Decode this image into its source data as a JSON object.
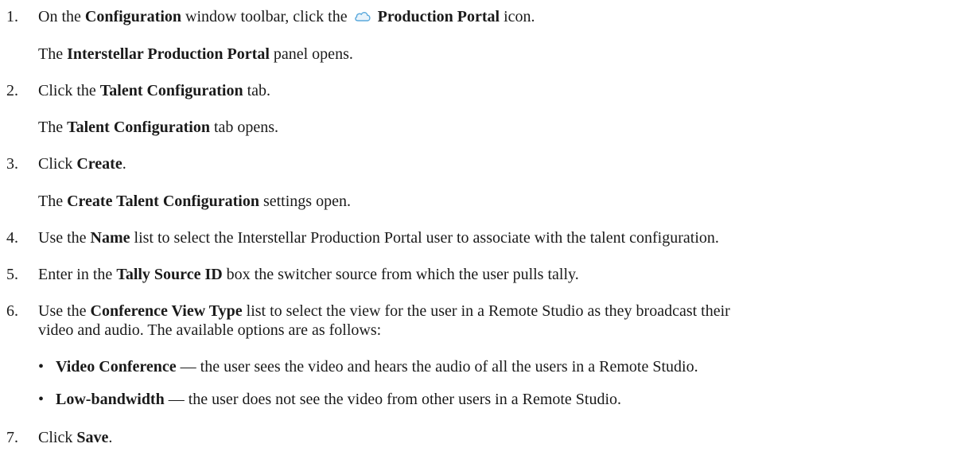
{
  "steps": [
    {
      "num": "1.",
      "pre": "On the ",
      "b1": "Configuration",
      "mid": " window toolbar, click the ",
      "icon": "cloud-icon",
      "b2": "Production Portal",
      "post": " icon.",
      "result_pre": "The ",
      "result_b": "Interstellar Production Portal",
      "result_post": " panel opens."
    },
    {
      "num": "2.",
      "pre": "Click the ",
      "b1": "Talent Configuration",
      "post": " tab.",
      "result_pre": "The ",
      "result_b": "Talent Configuration",
      "result_post": " tab opens."
    },
    {
      "num": "3.",
      "pre": "Click ",
      "b1": "Create",
      "post": ".",
      "result_pre": "The ",
      "result_b": "Create Talent Configuration",
      "result_post": " settings open."
    },
    {
      "num": "4.",
      "pre": "Use the ",
      "b1": "Name",
      "post": " list to select the Interstellar Production Portal user to associate with the talent configuration."
    },
    {
      "num": "5.",
      "pre": "Enter in the ",
      "b1": "Tally Source ID",
      "post": " box the switcher source from which the user pulls tally."
    },
    {
      "num": "6.",
      "pre": "Use the ",
      "b1": "Conference View Type",
      "post": " list to select the view for the user in a Remote Studio as they broadcast their",
      "cont": "video and audio. The available options are as follows:",
      "bullets": [
        {
          "b": "Video Conference",
          "text": " — the user sees the video and hears the audio of all the users in a Remote Studio."
        },
        {
          "b": "Low-bandwidth",
          "text": " — the user does not see the video from other users in a Remote Studio."
        }
      ]
    },
    {
      "num": "7.",
      "pre": "Click ",
      "b1": "Save",
      "post": "."
    }
  ],
  "bullet_glyph": "•",
  "icon_colors": {
    "cloud_fill": "#e8f3fb",
    "cloud_stroke": "#5aa9dc"
  }
}
